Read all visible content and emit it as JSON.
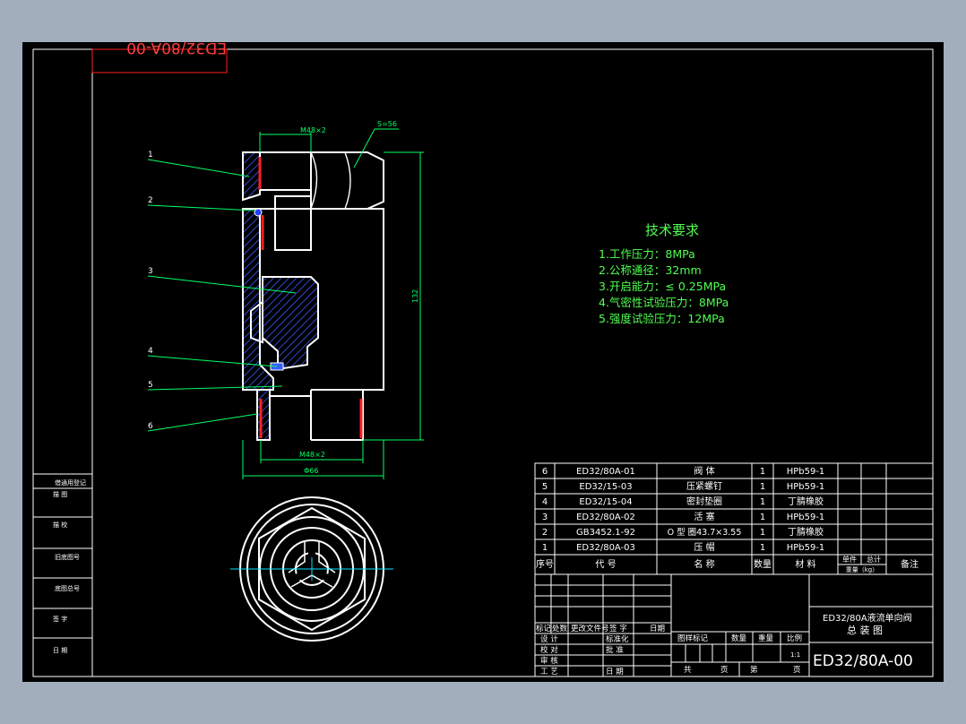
{
  "drawing_number": "ED32/80A-00",
  "mirrored_drawing_number": "ED32/80A-00",
  "dimensions": {
    "thread_top": "M48×2",
    "wrench": "S=56",
    "height": "132",
    "thread_bottom": "M48×2",
    "diameter": "Φ66"
  },
  "balloons": [
    "1",
    "2",
    "3",
    "4",
    "5",
    "6"
  ],
  "tech_requirements": {
    "title": "技术要求",
    "items": [
      "1.工作压力：8MPa",
      "2.公称通径：32mm",
      "3.开启能力：≤ 0.25MPa",
      "4.气密性试验压力：8MPa",
      "5.强度试验压力：12MPa"
    ]
  },
  "left_strip_labels": [
    "借通用登记",
    "描 图",
    "描 校",
    "旧底图号",
    "底图总号",
    "签 字",
    "日 期"
  ],
  "bom": {
    "rows": [
      {
        "no": "6",
        "code": "ED32/80A-01",
        "name": "阀 体",
        "qty": "1",
        "material": "HPb59-1"
      },
      {
        "no": "5",
        "code": "ED32/15-03",
        "name": "压紧螺钉",
        "qty": "1",
        "material": "HPb59-1"
      },
      {
        "no": "4",
        "code": "ED32/15-04",
        "name": "密封垫圈",
        "qty": "1",
        "material": "丁腈橡胶"
      },
      {
        "no": "3",
        "code": "ED32/80A-02",
        "name": "活 塞",
        "qty": "1",
        "material": "HPb59-1"
      },
      {
        "no": "2",
        "code": "GB3452.1-92",
        "name": "O 型 圈43.7×3.55",
        "qty": "1",
        "material": "丁腈橡胶"
      },
      {
        "no": "1",
        "code": "ED32/80A-03",
        "name": "压 帽",
        "qty": "1",
        "material": "HPb59-1"
      }
    ],
    "header": {
      "no": "序号",
      "code": "代 号",
      "name": "名 称",
      "qty": "数量",
      "material": "材 料",
      "weight1": "单件",
      "weight2": "总计",
      "weight3": "重量（kg）",
      "remarks": "备注"
    }
  },
  "title_block": {
    "rev_headers": [
      "标记",
      "处数",
      "更改文件号",
      "签 字",
      "日期"
    ],
    "sign_rows": [
      [
        "设 计",
        "标准化"
      ],
      [
        "校 对",
        "批 准"
      ],
      [
        "审 核",
        ""
      ],
      [
        "工 艺",
        "日 期"
      ]
    ],
    "stage_label": "图样标记",
    "qty_label": "数量",
    "weight_label": "重量",
    "scale_label": "比例",
    "scale_value": "1:1",
    "sheet_total": "共",
    "sheet_total_unit": "页",
    "sheet_no": "第",
    "sheet_no_unit": "页",
    "product_name": "ED32/80A液流单向阀",
    "drawing_title": "总 装 图",
    "drawing_number": "ED32/80A-00"
  },
  "colors": {
    "background": "#000000",
    "outer_bg": "#a3aebd",
    "line": "#ffffff",
    "dimension": "#00ff66",
    "hatch": "#3a5cff",
    "accent_red": "#ff2020",
    "centerline": "#00e5ff",
    "text_green": "#50ff50"
  }
}
